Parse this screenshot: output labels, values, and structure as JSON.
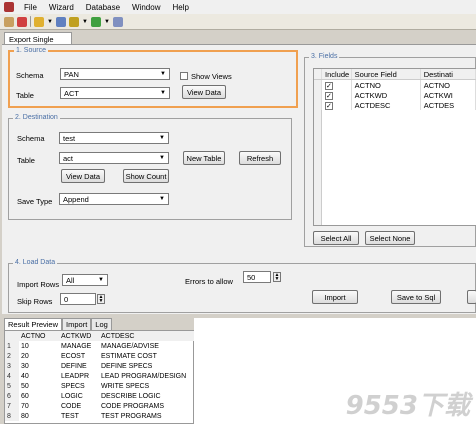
{
  "menu": [
    "File",
    "Wizard",
    "Database",
    "Window",
    "Help"
  ],
  "doc_tab": "Export Single Table",
  "source": {
    "title": "1. Source",
    "schema_label": "Schema",
    "schema_value": "PAN",
    "table_label": "Table",
    "table_value": "ACT",
    "show_views_label": "Show Views",
    "view_data_label": "View Data"
  },
  "destination": {
    "title": "2. Destination",
    "schema_label": "Schema",
    "schema_value": "test",
    "table_label": "Table",
    "table_value": "act",
    "new_table_label": "New Table",
    "refresh_label": "Refresh",
    "view_data_label": "View Data",
    "show_count_label": "Show Count",
    "save_type_label": "Save Type",
    "save_type_value": "Append"
  },
  "fields": {
    "title": "3. Fields",
    "columns": [
      "Include",
      "Source Field",
      "Destinati"
    ],
    "rows": [
      {
        "include": "✓",
        "source": "ACTNO",
        "dest": "ACTNO"
      },
      {
        "include": "✓",
        "source": "ACTKWD",
        "dest": "ACTKWI"
      },
      {
        "include": "✓",
        "source": "ACTDESC",
        "dest": "ACTDES"
      }
    ],
    "select_all_label": "Select All",
    "select_none_label": "Select None"
  },
  "load": {
    "title": "4. Load Data",
    "import_rows_label": "Import Rows",
    "import_rows_value": "All",
    "errors_label": "Errors to allow",
    "errors_value": "50",
    "skip_rows_label": "Skip Rows",
    "skip_rows_value": "0",
    "import_label": "Import",
    "save_sql_label": "Save to Sql"
  },
  "result_tabs": [
    "Result Preview",
    "Import",
    "Log"
  ],
  "results": {
    "columns": [
      "ACTNO",
      "ACTKWD",
      "ACTDESC"
    ],
    "rows": [
      [
        "1",
        "10",
        "MANAGE",
        "MANAGE/ADVISE"
      ],
      [
        "2",
        "20",
        "ECOST",
        "ESTIMATE COST"
      ],
      [
        "3",
        "30",
        "DEFINE",
        "DEFINE SPECS"
      ],
      [
        "4",
        "40",
        "LEADPR",
        "LEAD PROGRAM/DESIGN"
      ],
      [
        "5",
        "50",
        "SPECS",
        "WRITE SPECS"
      ],
      [
        "6",
        "60",
        "LOGIC",
        "DESCRIBE LOGIC"
      ],
      [
        "7",
        "70",
        "CODE",
        "CODE PROGRAMS"
      ],
      [
        "8",
        "80",
        "TEST",
        "TEST PROGRAMS"
      ]
    ]
  },
  "watermark": "9553下载",
  "colors": {
    "highlight": "#f0a050",
    "group_title": "#4a6fa5"
  }
}
